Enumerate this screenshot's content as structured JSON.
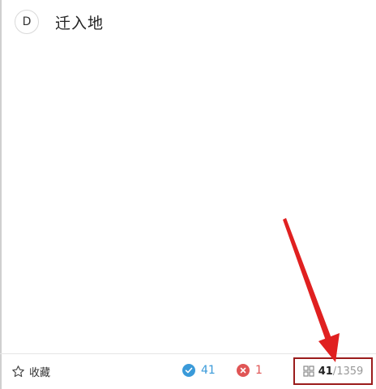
{
  "question": {
    "option_letter": "D",
    "option_text": "迁入地"
  },
  "footer": {
    "favorite_label": "收藏",
    "correct_count": "41",
    "wrong_count": "1",
    "progress_current": "41",
    "progress_separator": "/",
    "progress_total": "1359"
  },
  "colors": {
    "correct": "#3a9ad9",
    "wrong": "#e05555",
    "highlight_box": "#9b1c1c",
    "arrow": "#e02020"
  },
  "icons": {
    "favorite": "star-outline-icon",
    "correct": "check-circle-icon",
    "wrong": "x-circle-icon",
    "progress": "grid-icon"
  }
}
